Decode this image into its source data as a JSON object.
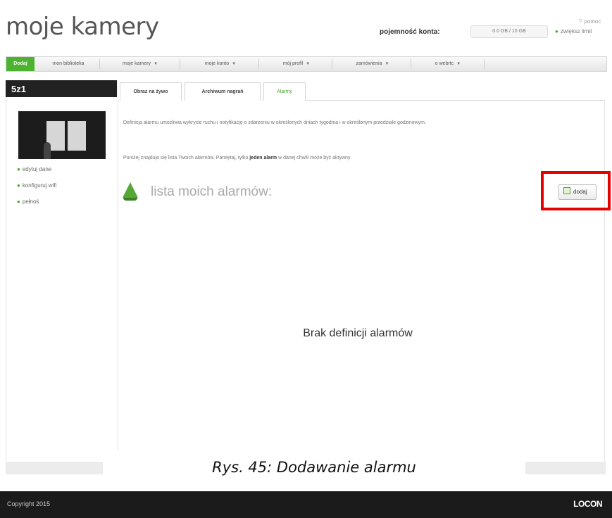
{
  "header": {
    "title": "moje kamery",
    "pojemnosc_label": "pojemność konta:",
    "pojemnosc_value": "0.0 GB / 10 GB",
    "help_label": "pomoc",
    "limit_label": "zwiększ limit"
  },
  "nav": {
    "items": [
      {
        "label": "Dodaj"
      },
      {
        "label": "mon biblioteka"
      },
      {
        "label": "moje kamery"
      },
      {
        "label": "moje konto"
      },
      {
        "label": "mój profil"
      },
      {
        "label": "zamówienia"
      },
      {
        "label": "o webrtc"
      }
    ]
  },
  "camera": {
    "name": "5z1",
    "links": [
      "edytuj dane",
      "konfiguruj wifi",
      "pełnoś"
    ]
  },
  "tabs": {
    "items": [
      {
        "label": "Obraz na żywo"
      },
      {
        "label": "Archiwum nagrań"
      },
      {
        "label": "Alarmy"
      }
    ]
  },
  "main": {
    "description1": "Definicja alarmu umożliwia wykrycie ruchu i notyfikację o zdarzeniu w określonych dniach tygodnia i w określonym przedziale godzinowym.",
    "description2_prefix": "Poniżej znajduje się lista Twoich alarmów. Pamiętaj, tylko ",
    "description2_bold": "jeden alarm",
    "description2_suffix": " w danej chwili może być aktywny.",
    "section_title": "lista moich alarmów:",
    "add_label": "dodaj",
    "empty_text": "Brak definicji alarmów"
  },
  "caption": "Rys. 45: Dodawanie alarmu",
  "footer": {
    "copyright": "Copyright 2015",
    "logo": "LOCON"
  },
  "colors": {
    "accent_green": "#4cb230",
    "highlight_red": "#e60000",
    "footer_bg": "#1b1b1b"
  }
}
